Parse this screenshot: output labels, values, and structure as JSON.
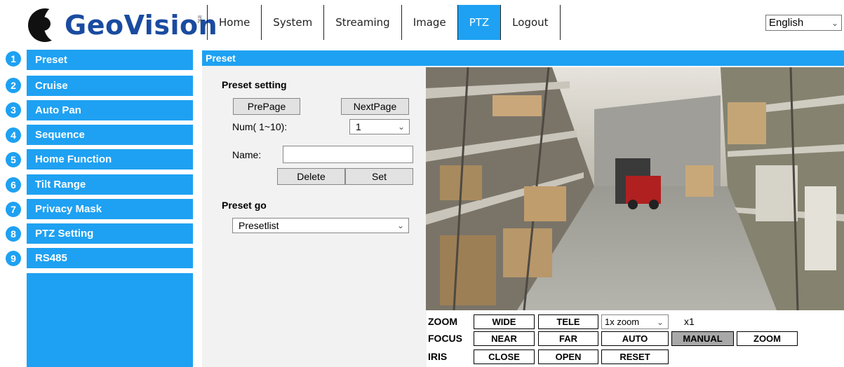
{
  "header": {
    "logo_text": "GeoVision",
    "logo_inc": "inc",
    "nav": [
      "Home",
      "System",
      "Streaming",
      "Image",
      "PTZ",
      "Logout"
    ],
    "active_nav": "PTZ",
    "language": "English"
  },
  "sidebar": {
    "items": [
      {
        "num": "1",
        "label": "Preset"
      },
      {
        "num": "2",
        "label": "Cruise"
      },
      {
        "num": "3",
        "label": "Auto Pan"
      },
      {
        "num": "4",
        "label": "Sequence"
      },
      {
        "num": "5",
        "label": "Home Function"
      },
      {
        "num": "6",
        "label": "Tilt Range"
      },
      {
        "num": "7",
        "label": "Privacy Mask"
      },
      {
        "num": "8",
        "label": "PTZ Setting"
      },
      {
        "num": "9",
        "label": "RS485"
      }
    ]
  },
  "main": {
    "title": "Preset",
    "preset_setting": {
      "heading": "Preset setting",
      "prev_page": "PrePage",
      "next_page": "NextPage",
      "num_label": "Num( 1~10):",
      "num_value": "1",
      "name_label": "Name:",
      "name_value": "",
      "delete": "Delete",
      "set": "Set"
    },
    "preset_go": {
      "heading": "Preset go",
      "select_value": "Presetlist"
    }
  },
  "controls": {
    "zoom": {
      "label": "ZOOM",
      "wide": "WIDE",
      "tele": "TELE",
      "zoom_select": "1x zoom",
      "zoom_value": "x1"
    },
    "focus": {
      "label": "FOCUS",
      "near": "NEAR",
      "far": "FAR",
      "auto": "AUTO",
      "manual": "MANUAL",
      "zoom": "ZOOM",
      "active": "MANUAL"
    },
    "iris": {
      "label": "IRIS",
      "close": "CLOSE",
      "open": "OPEN",
      "reset": "RESET"
    }
  },
  "colors": {
    "accent": "#1ea1f2",
    "logo_blue": "#1a4ba0",
    "panel_bg": "#f2f2f2"
  }
}
